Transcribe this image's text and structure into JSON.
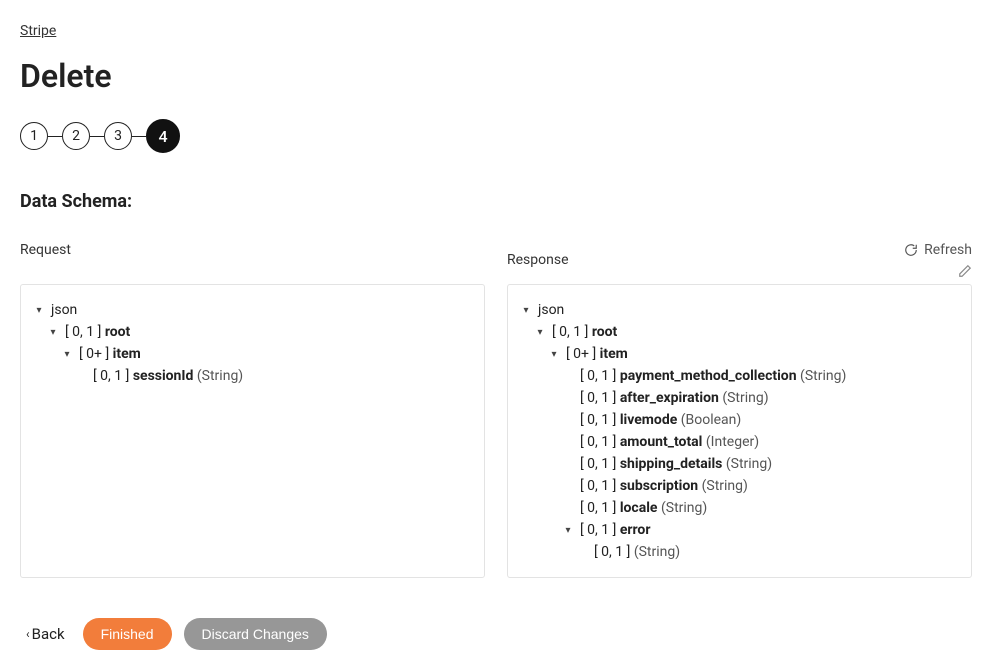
{
  "breadcrumb": "Stripe",
  "title": "Delete",
  "steps": [
    "1",
    "2",
    "3",
    "4"
  ],
  "active_step_index": 3,
  "section_label": "Data Schema:",
  "actions": {
    "refresh": "Refresh"
  },
  "panels": {
    "request": {
      "title": "Request",
      "tree": [
        {
          "indent": 0,
          "chevron": "down",
          "text": "json"
        },
        {
          "indent": 1,
          "chevron": "down",
          "card": "[ 0, 1 ]",
          "name": "root"
        },
        {
          "indent": 2,
          "chevron": "down",
          "card": "[ 0+ ]",
          "name": "item"
        },
        {
          "indent": 3,
          "chevron": "none",
          "card": "[ 0, 1 ]",
          "name": "sessionId",
          "type": "(String)"
        }
      ]
    },
    "response": {
      "title": "Response",
      "tree": [
        {
          "indent": 0,
          "chevron": "down",
          "text": "json"
        },
        {
          "indent": 1,
          "chevron": "down",
          "card": "[ 0, 1 ]",
          "name": "root"
        },
        {
          "indent": 2,
          "chevron": "down",
          "card": "[ 0+ ]",
          "name": "item"
        },
        {
          "indent": 3,
          "chevron": "none",
          "card": "[ 0, 1 ]",
          "name": "payment_method_collection",
          "type": "(String)"
        },
        {
          "indent": 3,
          "chevron": "none",
          "card": "[ 0, 1 ]",
          "name": "after_expiration",
          "type": "(String)"
        },
        {
          "indent": 3,
          "chevron": "none",
          "card": "[ 0, 1 ]",
          "name": "livemode",
          "type": "(Boolean)"
        },
        {
          "indent": 3,
          "chevron": "none",
          "card": "[ 0, 1 ]",
          "name": "amount_total",
          "type": "(Integer)"
        },
        {
          "indent": 3,
          "chevron": "none",
          "card": "[ 0, 1 ]",
          "name": "shipping_details",
          "type": "(String)"
        },
        {
          "indent": 3,
          "chevron": "none",
          "card": "[ 0, 1 ]",
          "name": "subscription",
          "type": "(String)"
        },
        {
          "indent": 3,
          "chevron": "none",
          "card": "[ 0, 1 ]",
          "name": "locale",
          "type": "(String)"
        },
        {
          "indent": 3,
          "chevron": "down",
          "card": "[ 0, 1 ]",
          "name": "error"
        },
        {
          "indent": 4,
          "chevron": "none",
          "card": "[ 0, 1 ]",
          "name": "",
          "type": "(String)"
        }
      ]
    }
  },
  "footer": {
    "back": "Back",
    "finished": "Finished",
    "discard": "Discard Changes"
  }
}
